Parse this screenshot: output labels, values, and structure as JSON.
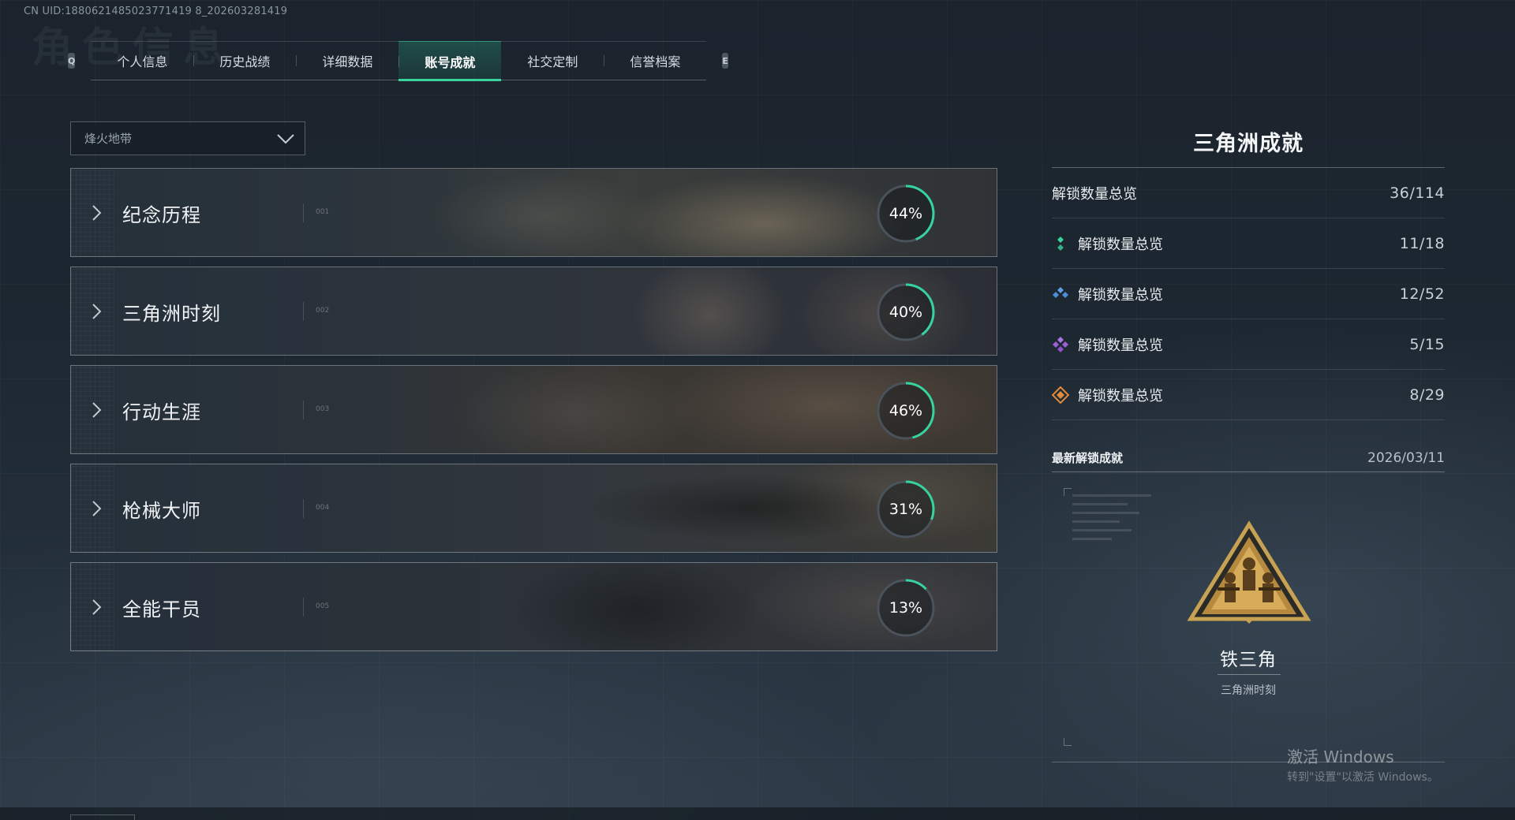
{
  "uid_text": "CN UID:1880621485023771419 8_202603281419",
  "bg_title": "角色信息",
  "tabs": {
    "left_key": "Q",
    "right_key": "E",
    "items": [
      {
        "label": "个人信息"
      },
      {
        "label": "历史战绩"
      },
      {
        "label": "详细数据"
      },
      {
        "label": "账号成就"
      },
      {
        "label": "社交定制"
      },
      {
        "label": "信誉档案"
      }
    ],
    "active_index": 3
  },
  "mode_select": {
    "value": "烽火地带"
  },
  "categories": [
    {
      "title": "纪念历程",
      "code": "001",
      "percent": 44,
      "percent_label": "44%"
    },
    {
      "title": "三角洲时刻",
      "code": "002",
      "percent": 40,
      "percent_label": "40%"
    },
    {
      "title": "行动生涯",
      "code": "003",
      "percent": 46,
      "percent_label": "46%"
    },
    {
      "title": "枪械大师",
      "code": "004",
      "percent": 31,
      "percent_label": "31%"
    },
    {
      "title": "全能干员",
      "code": "005",
      "percent": 13,
      "percent_label": "13%"
    }
  ],
  "panel": {
    "title": "三角洲成就",
    "total": {
      "label": "解锁数量总览",
      "value": "36/114"
    },
    "tiers": [
      {
        "label": "解锁数量总览",
        "value": "11/18",
        "icon": "green-gem-icon",
        "color": "#3ad39a"
      },
      {
        "label": "解锁数量总览",
        "value": "12/52",
        "icon": "blue-gem-icon",
        "color": "#4b8fd8"
      },
      {
        "label": "解锁数量总览",
        "value": "5/15",
        "icon": "purple-gem-icon",
        "color": "#9b5fd6"
      },
      {
        "label": "解锁数量总览",
        "value": "8/29",
        "icon": "orange-gem-icon",
        "color": "#e08a3c"
      }
    ],
    "latest": {
      "label": "最新解锁成就",
      "date": "2026/03/11",
      "name": "铁三角",
      "category": "三角洲时刻",
      "icon": "iron-triangle-emblem-icon"
    }
  },
  "watermark": {
    "line1": "激活 Windows",
    "line2": "转到\"设置\"以激活 Windows。"
  },
  "colors": {
    "accent": "#36d39d",
    "ring_track": "#4a535c"
  }
}
